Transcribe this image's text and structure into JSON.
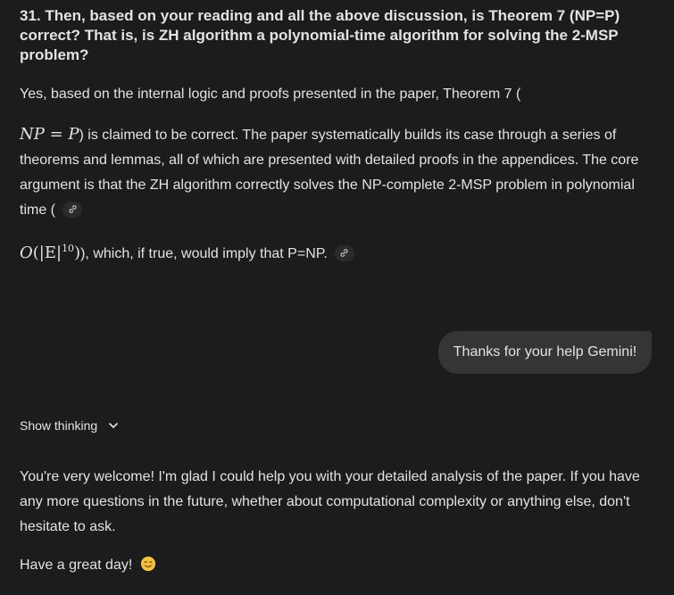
{
  "question": {
    "text": "31. Then, based on your reading and all the above discussion, is Theorem 7 (NP=P) correct? That is, is ZH algorithm a polynomial-time algorithm for solving the 2-MSP problem?"
  },
  "answer": {
    "line1": "Yes, based on the internal logic and proofs presented in the paper, Theorem 7 (",
    "math_np": "NP",
    "math_eq": " = ",
    "math_p": "P",
    "after_math": ") is claimed to be correct. The paper systematically builds its case through a series of theorems and lemmas, all of which are presented with detailed proofs in the appendices. The core argument is that the ZH algorithm correctly solves the NP-complete 2-MSP problem in polynomial time (",
    "complexity_o": "O",
    "complexity_e": "(|E|",
    "complexity_exp": "10",
    "complexity_close": ")",
    "after_complexity": "), which, if true, would imply that P=NP."
  },
  "user_message": {
    "text": "Thanks for your help Gemini!"
  },
  "show_thinking": {
    "label": "Show thinking",
    "icon": "chevron-down-icon"
  },
  "reply": {
    "para1": "You're very welcome! I'm glad I could help you with your detailed analysis of the paper. If you have any more questions in the future, whether about computational complexity or anything else, don't hesitate to ask.",
    "para2": "Have a great day!",
    "emoji": "smiling-face-emoji"
  },
  "colors": {
    "background": "#1b1c1d",
    "text": "#e3e3e3",
    "bubble": "#333537",
    "chip": "#2a2b2c"
  }
}
